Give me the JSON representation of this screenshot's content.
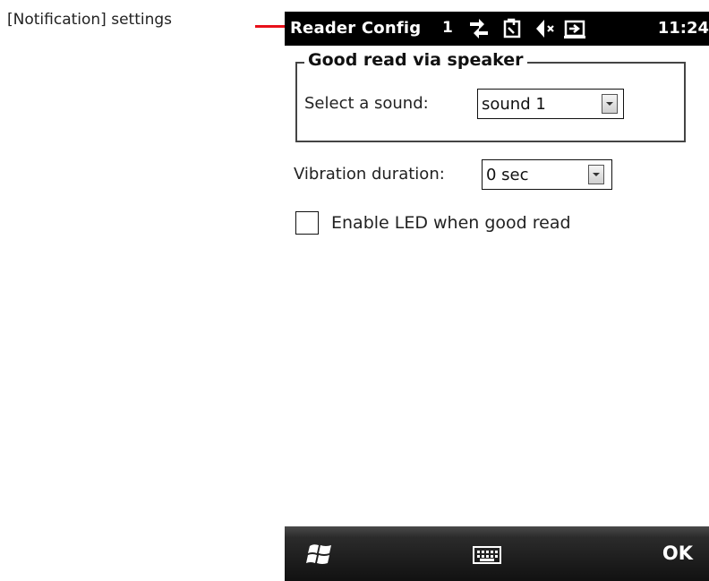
{
  "annotation": {
    "label": "[Notification] settings",
    "accent_color": "#e8101a"
  },
  "status_bar": {
    "app_title": "Reader Config",
    "signal_number": "1",
    "icons": [
      "data-connection-icon",
      "sync-icon",
      "volume-muted-icon",
      "battery-charging-icon"
    ],
    "time": "11:24"
  },
  "speaker_group": {
    "title": "Good read via speaker",
    "sound_label": "Select a sound:",
    "sound_value": "sound 1"
  },
  "vibration": {
    "label": "Vibration duration:",
    "value": "0 sec"
  },
  "led": {
    "label": "Enable LED when good read",
    "checked": false
  },
  "softkeys": {
    "start_icon": "windows-start-icon",
    "keyboard_icon": "keyboard-icon",
    "ok_label": "OK"
  }
}
